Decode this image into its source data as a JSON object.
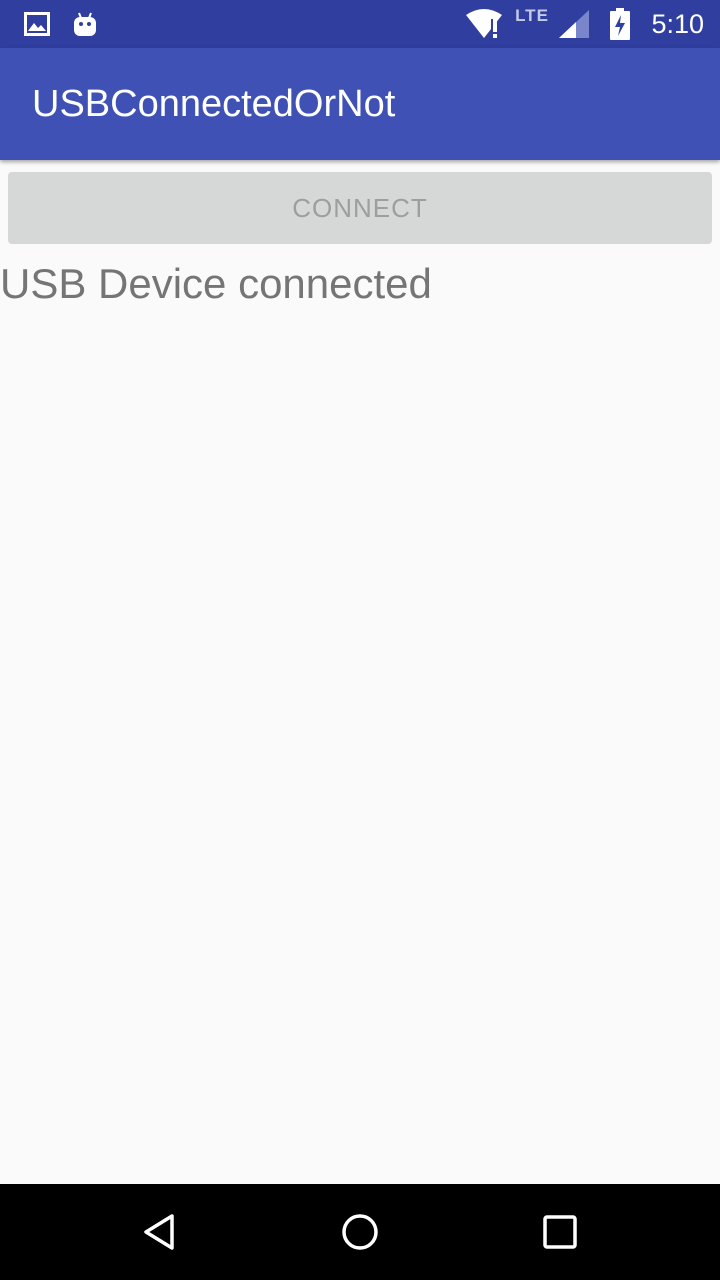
{
  "status_bar": {
    "time": "5:10",
    "network_label": "LTE",
    "icons": [
      "image-notification-icon",
      "android-notification-icon",
      "wifi-alert-icon",
      "lte-signal-icon",
      "battery-charging-icon"
    ]
  },
  "app_bar": {
    "title": "USBConnectedOrNot"
  },
  "main": {
    "connect_button_label": "CONNECT",
    "connect_button_enabled": false,
    "status_message": "USB Device connected"
  },
  "nav_bar": {
    "icons": [
      "back-icon",
      "home-icon",
      "recents-icon"
    ]
  },
  "colors": {
    "status_bar": "#303f9f",
    "app_bar": "#3f51b5",
    "background": "#fafafa",
    "button_disabled_bg": "#d6d7d7",
    "button_disabled_text": "#9e9e9e",
    "status_text": "#757575",
    "nav_bar": "#000000"
  }
}
